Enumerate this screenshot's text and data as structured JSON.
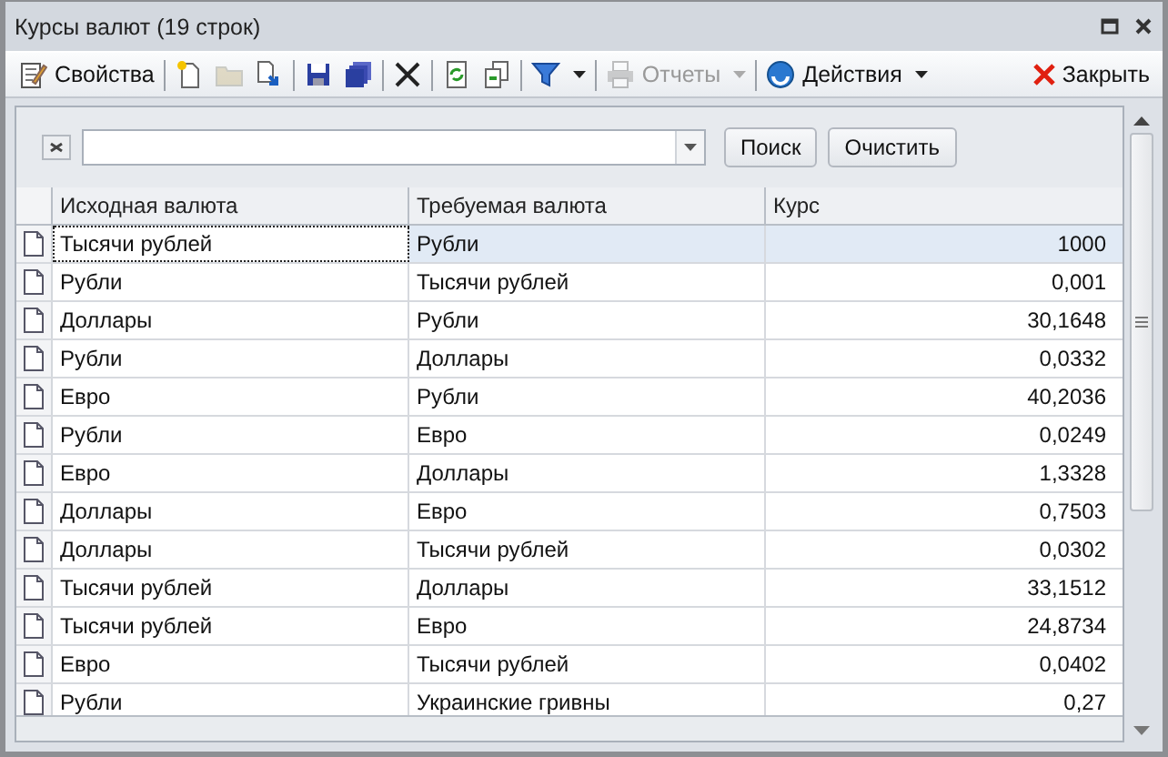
{
  "window": {
    "title": "Курсы валют (19 строк)"
  },
  "toolbar": {
    "groups": [
      [
        {
          "label": "Свойства",
          "disabled": false,
          "dropdown": false
        }
      ],
      [
        {
          "disabled": false
        },
        {
          "disabled": true
        },
        {
          "disabled": false
        }
      ],
      [
        {
          "disabled": false
        },
        {
          "disabled": false
        }
      ],
      [
        {
          "disabled": false
        }
      ],
      [
        {
          "disabled": false
        },
        {
          "disabled": false
        }
      ],
      [
        {
          "disabled": false,
          "dropdown": true
        }
      ],
      [
        {
          "label": "Отчеты",
          "disabled": true,
          "dropdown": true
        }
      ],
      [
        {
          "label": "Действия",
          "disabled": false,
          "dropdown": true
        }
      ]
    ],
    "close": {
      "label": "Закрыть"
    }
  },
  "search": {
    "button": "Поиск",
    "clear": "Очистить"
  },
  "table": {
    "columns": [
      "Исходная валюта",
      "Требуемая валюта",
      "Курс"
    ],
    "rows": [
      {
        "cells": [
          "Тысячи рублей",
          "Рубли",
          "1000"
        ],
        "selected": true
      },
      {
        "cells": [
          "Рубли",
          "Тысячи рублей",
          "0,001"
        ],
        "selected": false
      },
      {
        "cells": [
          "Доллары",
          "Рубли",
          "30,1648"
        ],
        "selected": false
      },
      {
        "cells": [
          "Рубли",
          "Доллары",
          "0,0332"
        ],
        "selected": false
      },
      {
        "cells": [
          "Евро",
          "Рубли",
          "40,2036"
        ],
        "selected": false
      },
      {
        "cells": [
          "Рубли",
          "Евро",
          "0,0249"
        ],
        "selected": false
      },
      {
        "cells": [
          "Евро",
          "Доллары",
          "1,3328"
        ],
        "selected": false
      },
      {
        "cells": [
          "Доллары",
          "Евро",
          "0,7503"
        ],
        "selected": false
      },
      {
        "cells": [
          "Доллары",
          "Тысячи рублей",
          "0,0302"
        ],
        "selected": false
      },
      {
        "cells": [
          "Тысячи рублей",
          "Доллары",
          "33,1512"
        ],
        "selected": false
      },
      {
        "cells": [
          "Тысячи рублей",
          "Евро",
          "24,8734"
        ],
        "selected": false
      },
      {
        "cells": [
          "Евро",
          "Тысячи рублей",
          "0,0402"
        ],
        "selected": false
      },
      {
        "cells": [
          "Рубли",
          "Украинские гривны",
          "0,27"
        ],
        "selected": false
      }
    ]
  }
}
